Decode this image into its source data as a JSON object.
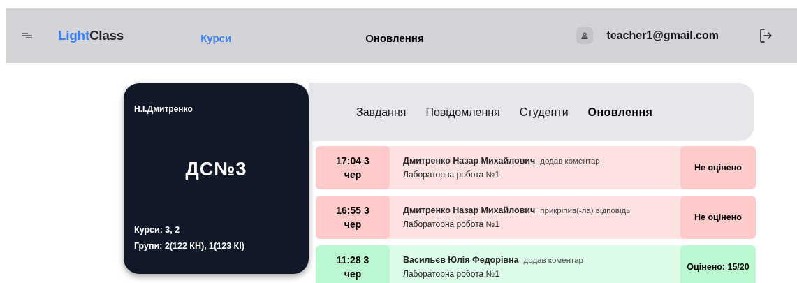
{
  "header": {
    "logo": {
      "part_1": "Light",
      "part_2": "Class"
    },
    "nav": [
      {
        "label": "Курси",
        "selected": true
      },
      {
        "label": "Оновлення",
        "selected": false
      }
    ],
    "user_email": "teacher1@gmail.com"
  },
  "course_card": {
    "teacher": "Н.І.Дмитренко",
    "title": "ДС№3",
    "courses": "Курси: 3, 2",
    "groups": "Групи: 2(122 КН), 1(123 КІ)"
  },
  "tabs": [
    {
      "label": "Завдання",
      "selected": false
    },
    {
      "label": "Повідомлення",
      "selected": false
    },
    {
      "label": "Студенти",
      "selected": false
    },
    {
      "label": "Оновлення",
      "selected": true
    }
  ],
  "updates": [
    {
      "time": "17:04 3 чер",
      "student": "Дмитренко Назар Михайлович",
      "action": "додав коментар",
      "task": "Лабораторна робота №1",
      "graded": false,
      "grade": "Не оцінено"
    },
    {
      "time": "16:55 3 чер",
      "student": "Дмитренко Назар Михайлович",
      "action": "прикріпив(-ла) відповідь",
      "task": "Лабораторна робота №1",
      "graded": false,
      "grade": "Не оцінено"
    },
    {
      "time": "11:28 3 чер",
      "student": "Васильєв Юлія Федорівна",
      "action": "додав коментар",
      "task": "Лабораторна робота №1",
      "graded": true,
      "grade": "Оцінено: 15/20"
    }
  ]
}
